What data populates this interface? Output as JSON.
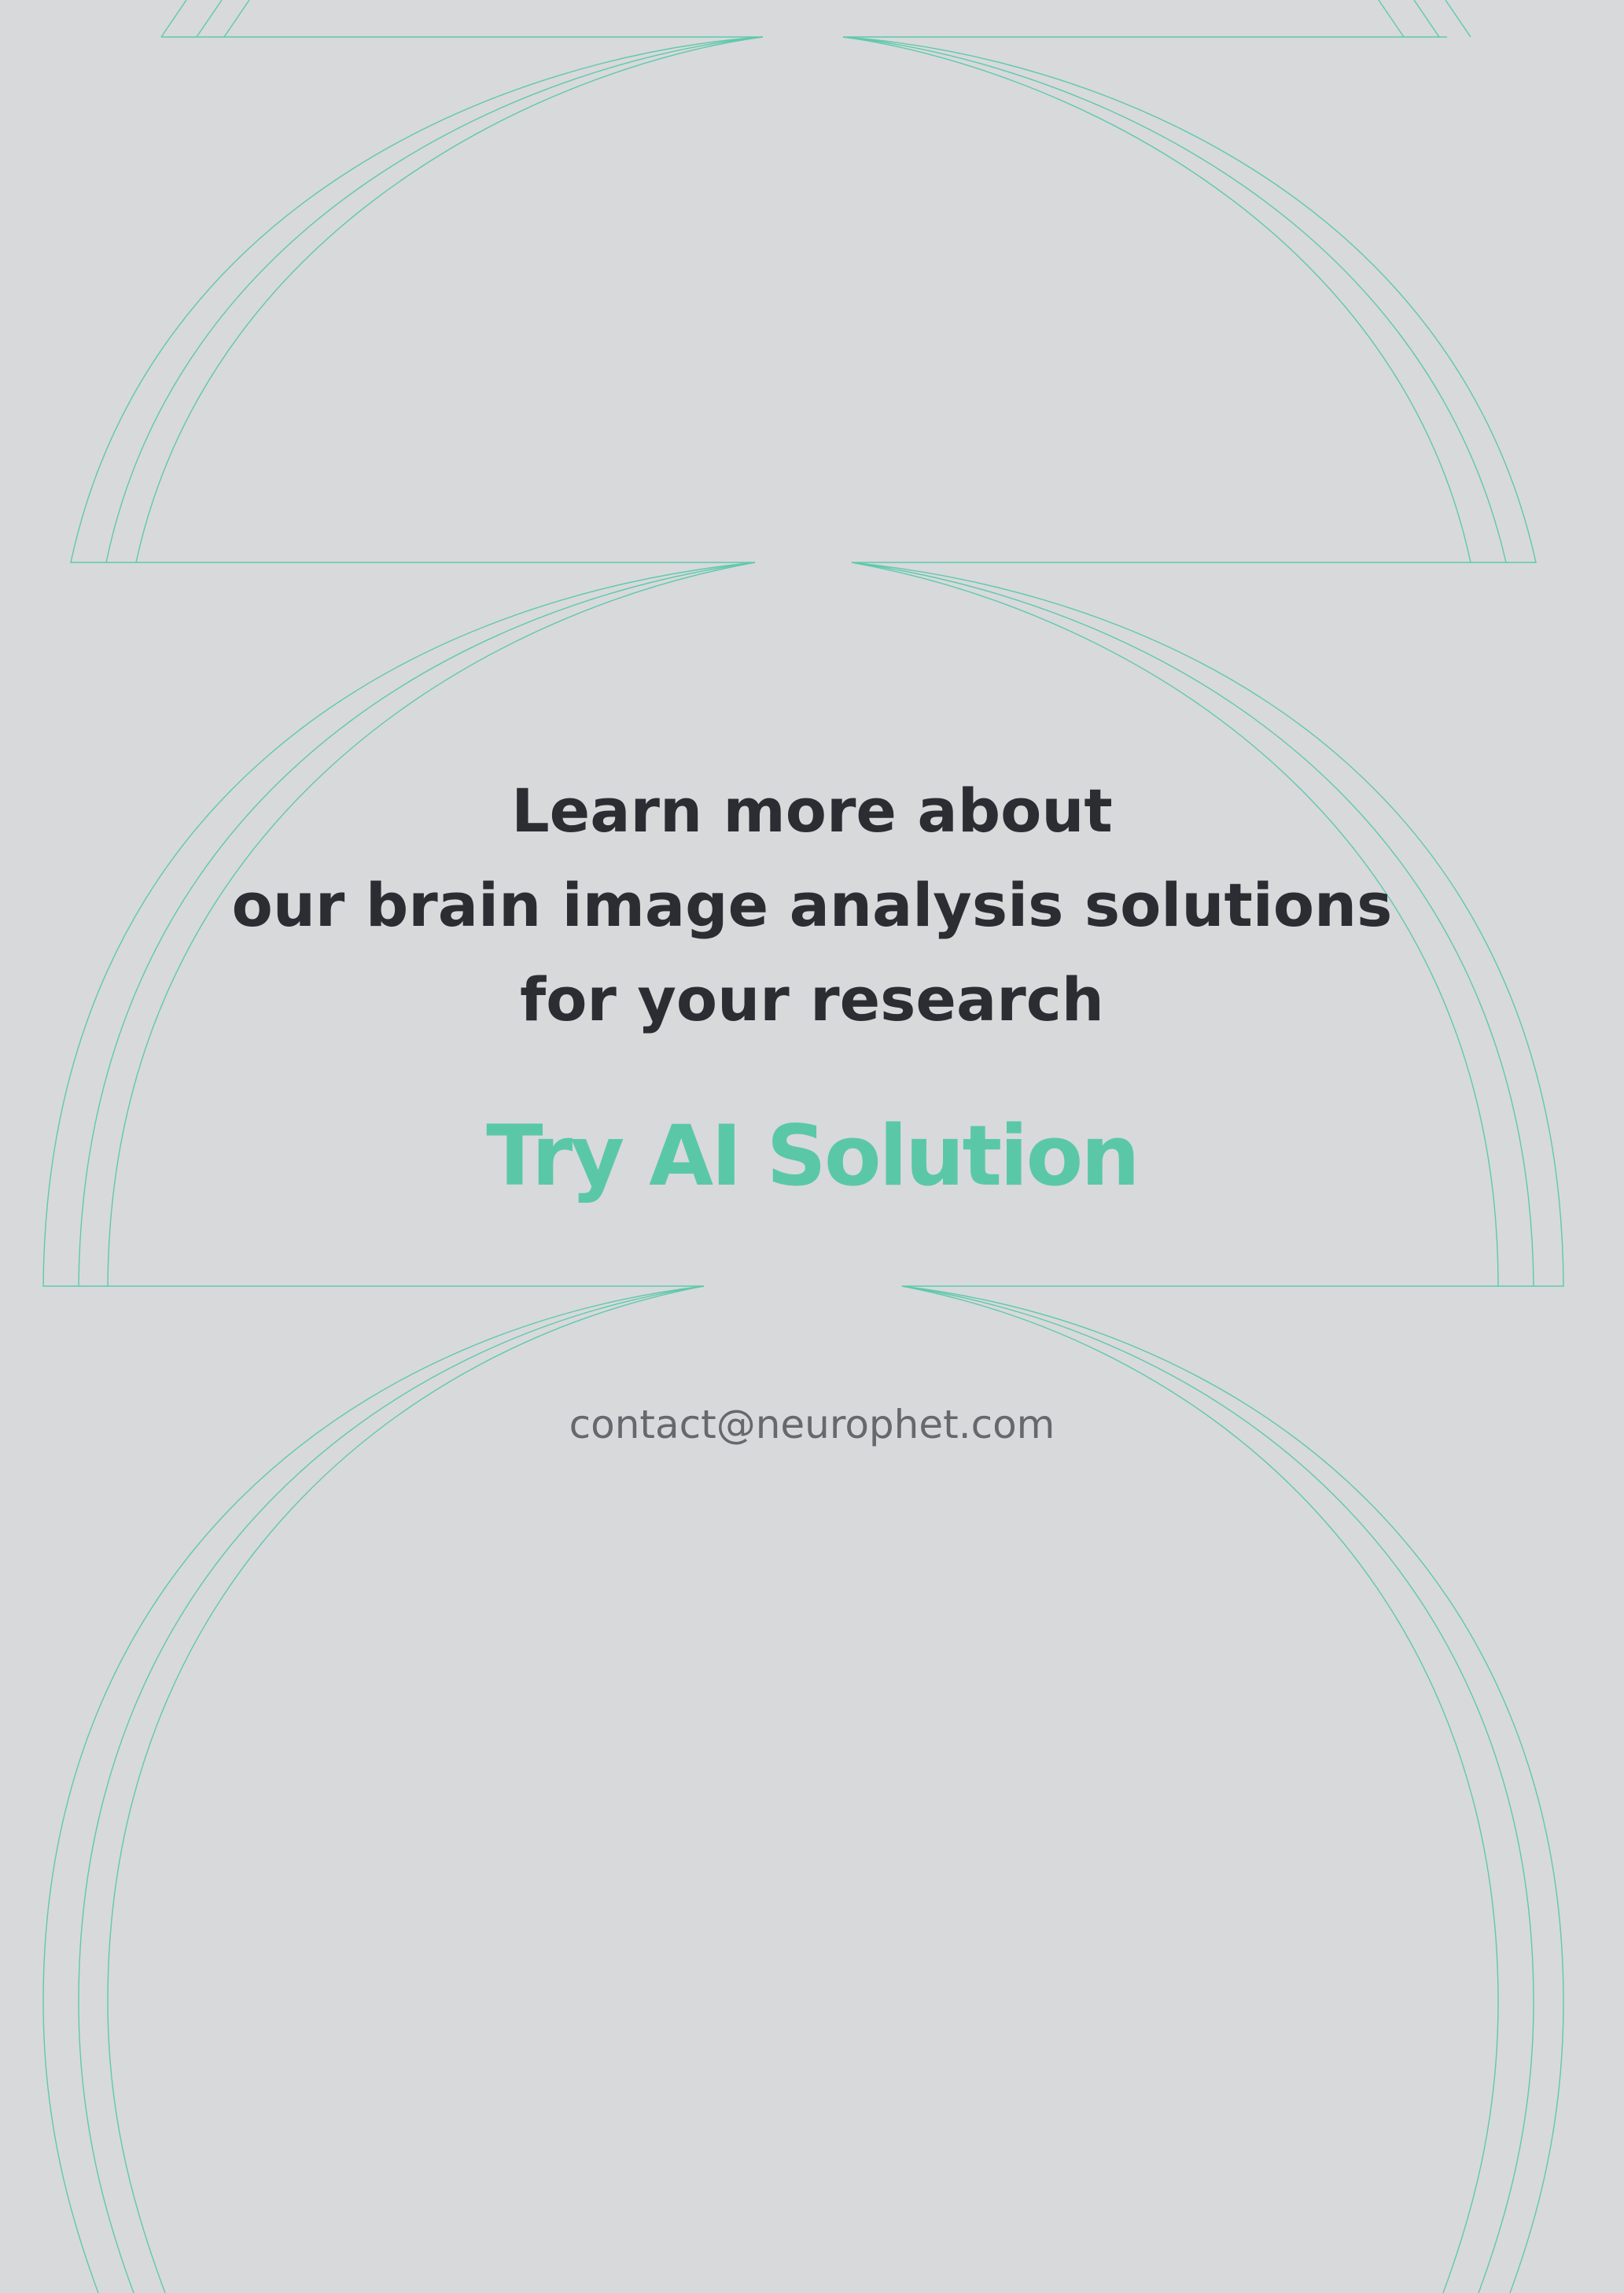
{
  "headline": {
    "line1": "Learn more about",
    "line2": "our brain image analysis solutions",
    "line3": "for your research"
  },
  "cta": {
    "label": "Try AI Solution"
  },
  "contact": {
    "email": "contact@neurophet.com"
  },
  "colors": {
    "background": "#d8d9db",
    "heading": "#2c2d33",
    "accent": "#5ac8a6",
    "contact_text": "#67686d"
  }
}
